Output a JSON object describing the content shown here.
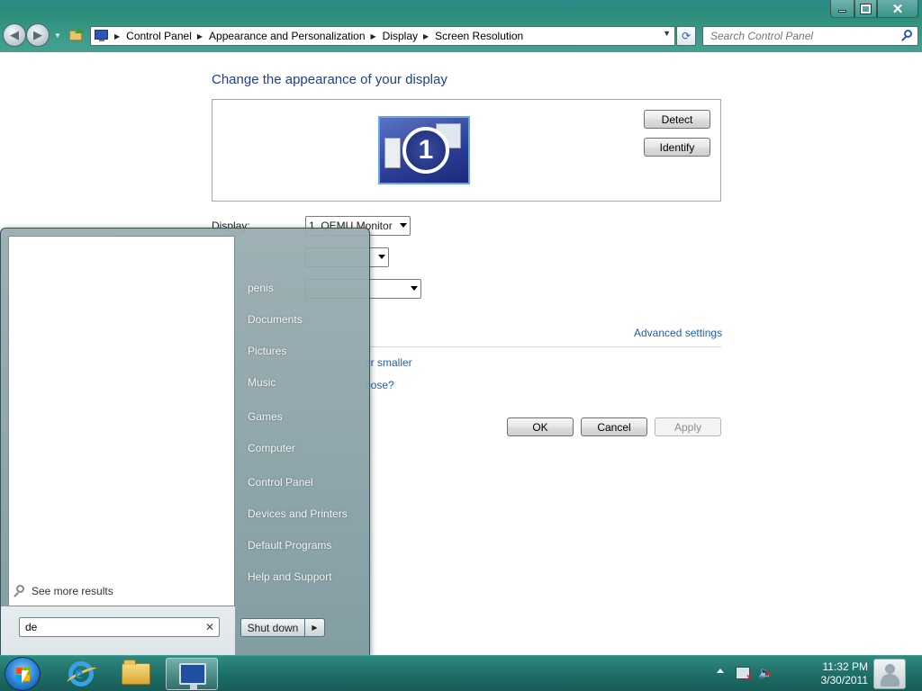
{
  "window": {
    "breadcrumbs": [
      "Control Panel",
      "Appearance and Personalization",
      "Display",
      "Screen Resolution"
    ],
    "search_placeholder": "Search Control Panel"
  },
  "display_settings": {
    "title": "Change the appearance of your display",
    "monitor_number": "1",
    "detect_label": "Detect",
    "identify_label": "Identify",
    "display_label": "Display:",
    "display_value": "1. QEMU Monitor",
    "advanced_link": "Advanced settings",
    "text_size_link_fragment": "or smaller",
    "choose_link_fragment": "oose?",
    "ok_label": "OK",
    "cancel_label": "Cancel",
    "apply_label": "Apply"
  },
  "start_menu": {
    "right_items": [
      "penis",
      "Documents",
      "Pictures",
      "Music",
      "Games",
      "Computer",
      "Control Panel",
      "Devices and Printers",
      "Default Programs",
      "Help and Support"
    ],
    "see_more": "See more results",
    "search_value": "de",
    "shutdown_label": "Shut down"
  },
  "taskbar": {
    "time": "11:32 PM",
    "date": "3/30/2011",
    "pinned_icons": [
      "internet-explorer-icon",
      "windows-explorer-icon",
      "control-panel-icon"
    ]
  },
  "colors": {
    "title_blue": "#1f3e8f",
    "link_blue": "#1f5fa8",
    "glass_teal": "#2f8a80"
  }
}
